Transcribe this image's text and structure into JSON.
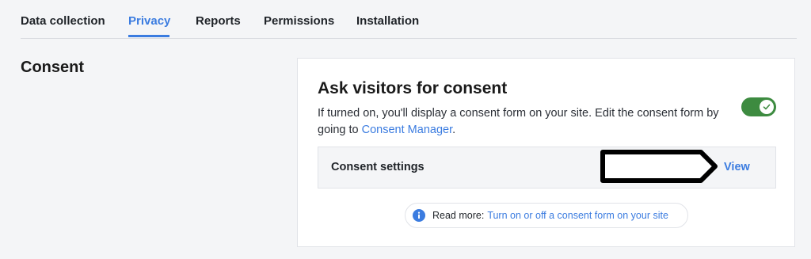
{
  "tabs": [
    {
      "label": "Data collection",
      "active": false
    },
    {
      "label": "Privacy",
      "active": true
    },
    {
      "label": "Reports",
      "active": false
    },
    {
      "label": "Permissions",
      "active": false
    },
    {
      "label": "Installation",
      "active": false
    }
  ],
  "section": {
    "title": "Consent"
  },
  "card": {
    "title": "Ask visitors for consent",
    "description_prefix": "If turned on, you'll display a consent form on your site. Edit the consent form by going to ",
    "description_link": "Consent Manager",
    "description_suffix": ".",
    "toggle_on": true
  },
  "settings_row": {
    "label": "Consent settings",
    "action_label": "View"
  },
  "read_more": {
    "label": "Read more:",
    "link": "Turn on or off a consent form on your site"
  },
  "colors": {
    "accent": "#3b7ce0",
    "toggle_on": "#3d8b40",
    "background": "#f4f5f7"
  },
  "icons": {
    "info": "info-icon",
    "toggle_check": "checkmark-icon"
  }
}
